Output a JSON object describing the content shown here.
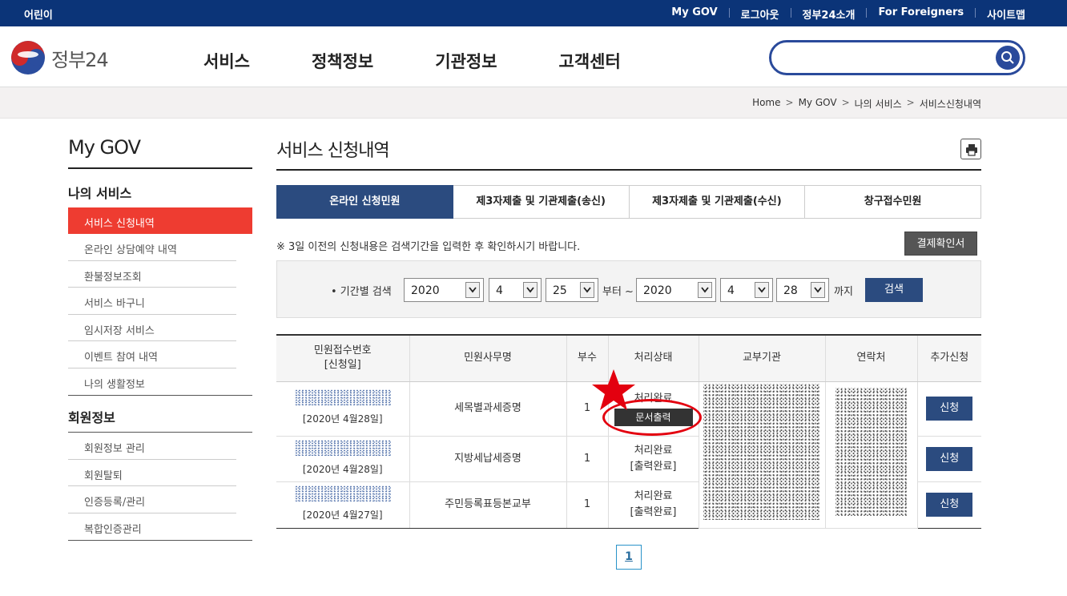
{
  "topbar": {
    "kids": "어린이",
    "links": [
      "My GOV",
      "로그아웃",
      "정부24소개",
      "For Foreigners",
      "사이트맵"
    ]
  },
  "header": {
    "logo_text": "정부24",
    "nav": [
      "서비스",
      "정책정보",
      "기관정보",
      "고객센터"
    ],
    "search": {
      "value": "",
      "placeholder": ""
    }
  },
  "breadcrumb": [
    "Home",
    "My GOV",
    "나의 서비스",
    "서비스신청내역"
  ],
  "sidebar": {
    "title": "My GOV",
    "section1": "나의 서비스",
    "active": "서비스 신청내역",
    "items1": [
      "온라인 상담예약 내역",
      "환불정보조회",
      "서비스 바구니",
      "임시저장 서비스",
      "이벤트 참여 내역",
      "나의 생활정보"
    ],
    "section2": "회원정보",
    "items2": [
      "회원정보 관리",
      "회원탈퇴",
      "인증등록/관리",
      "복합인증관리"
    ]
  },
  "main": {
    "title": "서비스 신청내역",
    "tabs": [
      "온라인 신청민원",
      "제3자제출 및 기관제출(송신)",
      "제3자제출 및 기관제출(수신)",
      "창구접수민원"
    ],
    "notice": "※ 3일 이전의 신청내용은 검색기간을 입력한 후 확인하시기 바랍니다.",
    "receipt_button": "결제확인서",
    "search": {
      "label": "• 기간별 검색",
      "from_year": "2020",
      "from_month": "4",
      "from_day": "25",
      "from_text": "부터 ~",
      "to_year": "2020",
      "to_month": "4",
      "to_day": "28",
      "to_text": "까지",
      "button": "검색"
    },
    "table": {
      "headers": [
        "민원접수번호\n[신청일]",
        "민원사무명",
        "부수",
        "처리상태",
        "교부기관",
        "연락처",
        "추가신청"
      ],
      "header0_line1": "민원접수번호",
      "header0_line2": "[신청일]",
      "rows": [
        {
          "date": "[2020년 4월28일]",
          "name": "세목별과세증명",
          "copies": "1",
          "status": "처리완료",
          "action": "문서출력",
          "apply": "신청"
        },
        {
          "date": "[2020년 4월28일]",
          "name": "지방세납세증명",
          "copies": "1",
          "status": "처리완료",
          "action": "[출력완료]",
          "apply": "신청"
        },
        {
          "date": "[2020년 4월27일]",
          "name": "주민등록표등본교부",
          "copies": "1",
          "status": "처리완료",
          "action": "[출력완료]",
          "apply": "신청"
        }
      ]
    },
    "pagination": [
      "1"
    ]
  },
  "colors": {
    "topbar": "#0b3478",
    "primary": "#2b4b7f",
    "active_menu": "#ee3c31",
    "annotation": "#e3000f"
  },
  "icons": [
    "search-icon",
    "print-icon",
    "chevron-down-icon",
    "star-annotation",
    "ellipse-annotation"
  ]
}
